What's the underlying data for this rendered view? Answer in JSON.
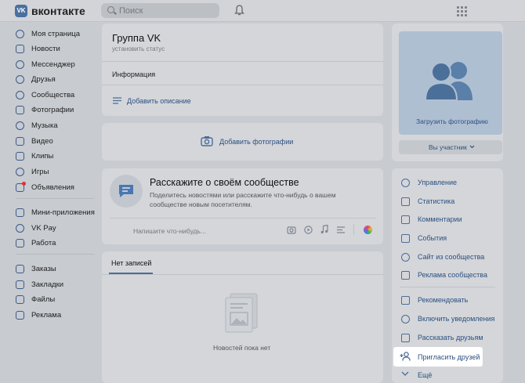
{
  "header": {
    "logo_mark": "VK",
    "logo_text": "вконтакте",
    "search_placeholder": "Поиск"
  },
  "nav": {
    "main": [
      "Моя страница",
      "Новости",
      "Мессенджер",
      "Друзья",
      "Сообщества",
      "Фотографии",
      "Музыка",
      "Видео",
      "Клипы",
      "Игры",
      "Объявления"
    ],
    "apps": [
      "Мини-приложения",
      "VK Pay",
      "Работа"
    ],
    "more": [
      "Заказы",
      "Закладки",
      "Файлы",
      "Реклама"
    ]
  },
  "group": {
    "name": "Группа VK",
    "status": "установить статус",
    "info_label": "Информация",
    "add_description": "Добавить описание"
  },
  "photos": {
    "add_photos": "Добавить фотографии"
  },
  "promo": {
    "title": "Расскажите о своём сообществе",
    "text_line1": "Поделитесь новостями или расскажите что-нибудь о вашем",
    "text_line2": "сообществе новым посетителям."
  },
  "composer": {
    "placeholder": "Напишите что-нибудь..."
  },
  "wall": {
    "tab": "Нет записей",
    "empty": "Новостей пока нет"
  },
  "cover": {
    "upload": "Загрузить фотографию",
    "member": "Вы участник"
  },
  "right_menu": {
    "group1": [
      "Управление",
      "Статистика",
      "Комментарии",
      "События",
      "Сайт из сообщества",
      "Реклама сообщества"
    ],
    "group2": [
      "Рекомендовать",
      "Включить уведомления",
      "Рассказать друзьям",
      "Пригласить друзей",
      "Ещё"
    ]
  },
  "colors": {
    "accent": "#2c5080",
    "highlight": "#ffffff",
    "overlay_bg": "#c8cbd0"
  }
}
